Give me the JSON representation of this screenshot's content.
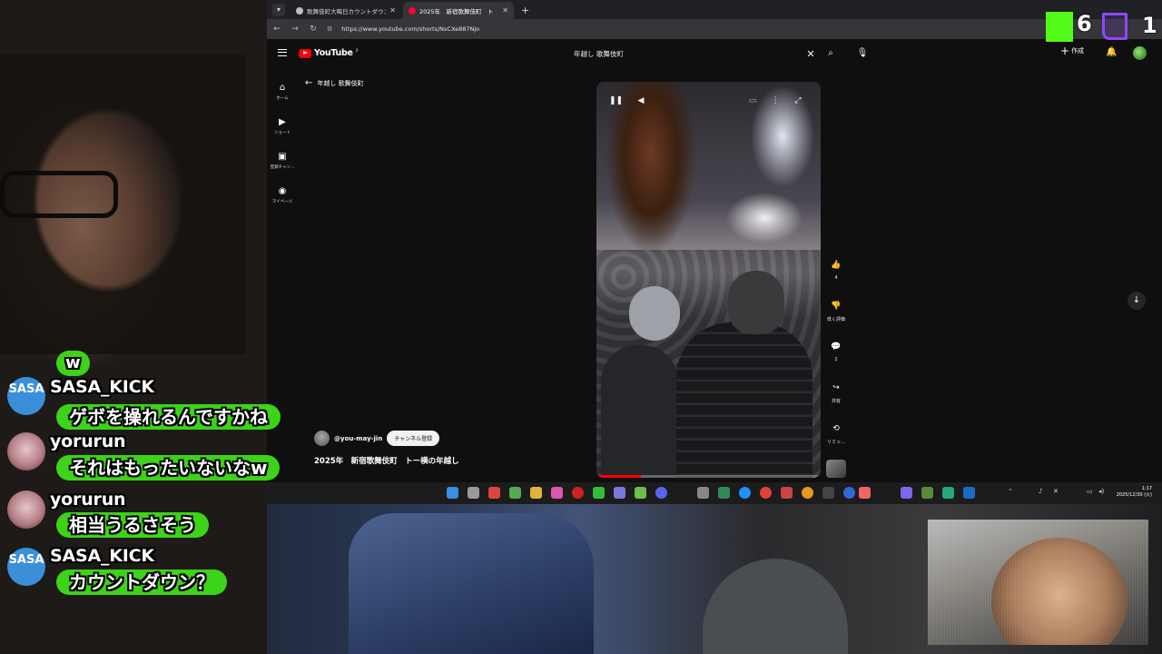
{
  "browser": {
    "tabs": [
      {
        "title": "歌舞伎町大晦日カウントダウン(",
        "active": false
      },
      {
        "title": "2025年　新宿歌舞伎町　ト",
        "active": true
      }
    ],
    "url": "https://www.youtube.com/shorts/NsCXe887Njo"
  },
  "youtube": {
    "logo": "YouTube",
    "logo_region": "JP",
    "search_query": "年越し 歌舞伎町",
    "create_label": "作成",
    "nav": [
      {
        "icon": "home-icon",
        "label": "ホーム"
      },
      {
        "icon": "shorts-icon",
        "label": "ショート"
      },
      {
        "icon": "subscriptions-icon",
        "label": "登録チャン..."
      },
      {
        "icon": "mypage-icon",
        "label": "マイページ"
      }
    ],
    "back_label": "年越し 歌舞伎町"
  },
  "short": {
    "channel": "@you-may-jin",
    "subscribe_label": "チャンネル登録",
    "title": "2025年　新宿歌舞伎町　トー横の年越し",
    "progress": 0.2,
    "actions": {
      "like_count": "4",
      "dislike_label": "低く評価",
      "comment_count": "2",
      "share_label": "共有",
      "remix_label": "リミッ..."
    }
  },
  "taskbar": {
    "time": "1:17",
    "date": "2025/12/30 (火)"
  },
  "overlay": {
    "kick_viewers": "6",
    "twitch_viewers": "1",
    "kick_color": "#53fc18",
    "twitch_color": "#9146ff",
    "bubble_color": "#3dd318"
  },
  "chat": [
    {
      "user": "",
      "avatar": "",
      "text": "w"
    },
    {
      "user": "SASA_KICK",
      "avatar": "SASA",
      "text": "ゲボを操れるんですかね"
    },
    {
      "user": "yorurun",
      "avatar": "",
      "text": "それはもったいないなw"
    },
    {
      "user": "yorurun",
      "avatar": "",
      "text": "相当うるさそう"
    },
    {
      "user": "SASA_KICK",
      "avatar": "SASA",
      "text": "カウントダウン？"
    }
  ]
}
